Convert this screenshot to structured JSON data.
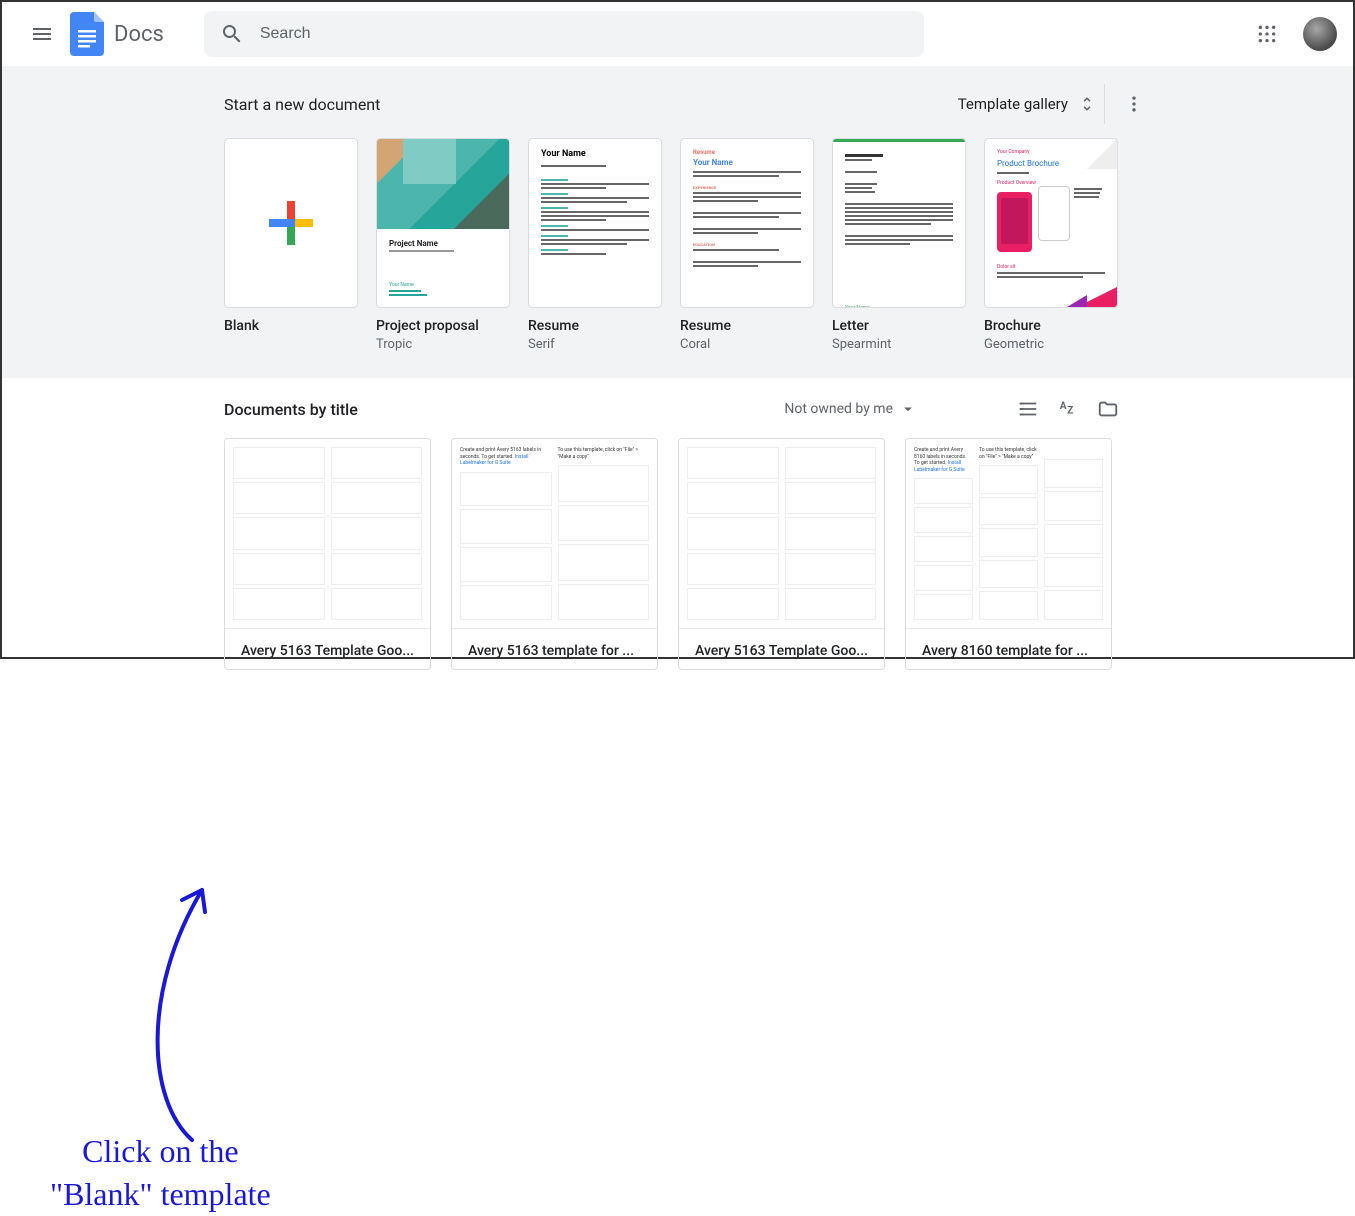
{
  "header": {
    "app_name": "Docs",
    "search_placeholder": "Search"
  },
  "templates": {
    "section_label": "Start a new document",
    "gallery_label": "Template gallery",
    "items": [
      {
        "title": "Blank",
        "subtitle": ""
      },
      {
        "title": "Project proposal",
        "subtitle": "Tropic"
      },
      {
        "title": "Resume",
        "subtitle": "Serif"
      },
      {
        "title": "Resume",
        "subtitle": "Coral"
      },
      {
        "title": "Letter",
        "subtitle": "Spearmint"
      },
      {
        "title": "Brochure",
        "subtitle": "Geometric"
      }
    ]
  },
  "docs": {
    "section_label": "Documents by title",
    "owned_filter": "Not owned by me",
    "items": [
      {
        "name": "Avery 5163 Template Goo..."
      },
      {
        "name": "Avery 5163 template for ..."
      },
      {
        "name": "Avery 5163 Template Goo..."
      },
      {
        "name": "Avery 8160 template for ..."
      }
    ]
  },
  "annotation": {
    "line1": "Click on the",
    "line2": "\"Blank\" template"
  },
  "thumb_text": {
    "your_name": "Your Name",
    "project_name": "Project Name",
    "resume": "Resume",
    "your_company": "Your Company",
    "product_brochure": "Product Brochure",
    "product_overview": "Product Overview",
    "label_header1": "Create and print Avery 5163 labels in seconds. To get started.",
    "label_link1": "Install Labelmaker for G Suite",
    "label_header2": "To use this template, click on \"File\" > \"Make a copy\"",
    "label_header_8160": "Create and print Avery 8160 labels in seconds. To get started."
  }
}
